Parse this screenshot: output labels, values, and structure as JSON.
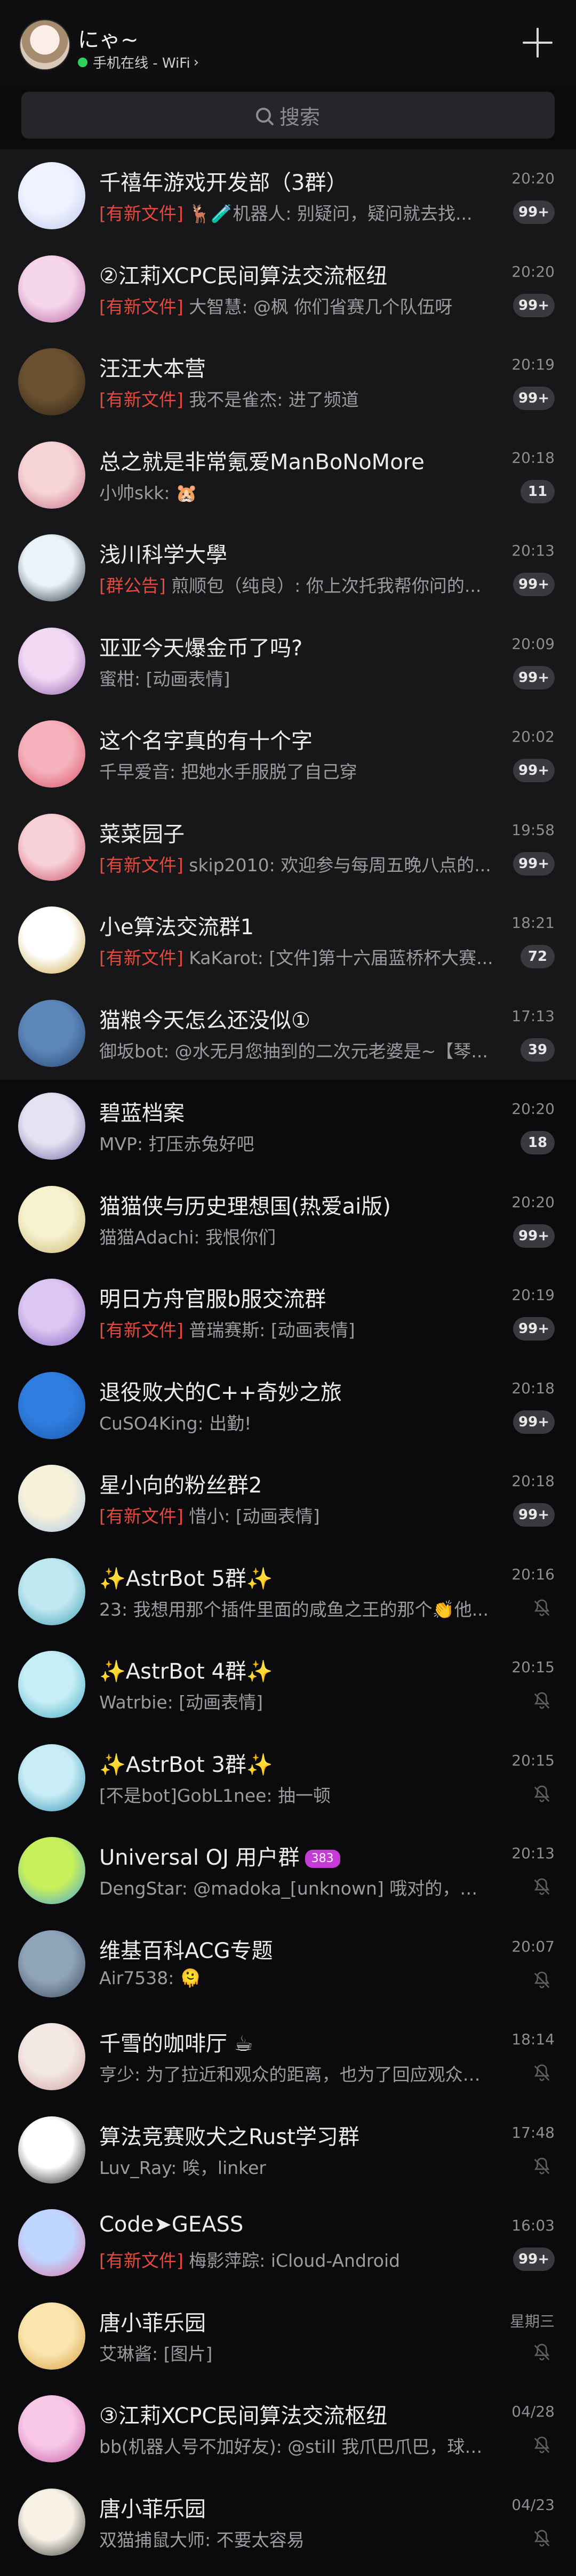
{
  "header": {
    "nickname": "にゃ~",
    "status": "手机在线 - WiFi",
    "status_chevron": "›"
  },
  "search": {
    "placeholder": "搜索"
  },
  "chats": [
    {
      "title": "千禧年游戏开发部（3群）",
      "tag": "[有新文件]",
      "preview": "🦌🧪机器人: 别疑问，疑问就去找...",
      "time": "20:20",
      "badge": "99+",
      "pinned": true,
      "c1": "#f0f2ff",
      "c2": "#b9c6ea"
    },
    {
      "title": "②江莉XCPC民间算法交流枢纽",
      "tag": "[有新文件]",
      "preview": "大智慧: @枫 你们省赛几个队伍呀",
      "time": "20:20",
      "badge": "99+",
      "pinned": true,
      "c1": "#f6d6ea",
      "c2": "#b55fa3"
    },
    {
      "title": "汪汪大本营",
      "tag": "[有新文件]",
      "preview": "我不是雀杰: 进了频道",
      "time": "20:19",
      "badge": "99+",
      "pinned": true,
      "c1": "#6b5130",
      "c2": "#2a2013"
    },
    {
      "title": "总之就是非常氪爱ManBoNoMore",
      "tag": "",
      "preview": "小帅skk: 🐹",
      "time": "20:18",
      "badge": "11",
      "pinned": true,
      "c1": "#f7d5d7",
      "c2": "#c46b86"
    },
    {
      "title": "浅川科学大學",
      "tag": "[群公告]",
      "preview": "煎顺包（纯良）: 你上次托我帮你问的...",
      "time": "20:13",
      "badge": "99+",
      "pinned": true,
      "c1": "#eaf3f8",
      "c2": "#1c2a3a"
    },
    {
      "title": "亚亚今天爆金币了吗?",
      "tag": "",
      "preview": "蜜柑: [动画表情]",
      "time": "20:09",
      "badge": "99+",
      "pinned": true,
      "c1": "#f1d9f4",
      "c2": "#8c5aa6"
    },
    {
      "title": "这个名字真的有十个字",
      "tag": "",
      "preview": "千早爱音: 把她水手服脱了自己穿",
      "time": "20:02",
      "badge": "99+",
      "pinned": true,
      "c1": "#f5b2bc",
      "c2": "#d84d62"
    },
    {
      "title": "菜菜园子",
      "tag": "[有新文件]",
      "preview": "skip2010: 欢迎参与每周五晚八点的...",
      "time": "19:58",
      "badge": "99+",
      "pinned": true,
      "c1": "#f8d0d8",
      "c2": "#c84b5c"
    },
    {
      "title": "小e算法交流群1",
      "tag": "[有新文件]",
      "preview": "KaKarot: [文件]第十六届蓝桥杯大赛...",
      "time": "18:21",
      "badge": "72",
      "pinned": true,
      "c1": "#ffffff",
      "c2": "#c9a235"
    },
    {
      "title": "猫粮今天怎么还没似①",
      "tag": "",
      "preview": "御坂bot: @水无月您抽到的二次元老婆是~【琴...",
      "time": "17:13",
      "badge": "39",
      "pinned": true,
      "c1": "#5d86b9",
      "c2": "#23446f"
    },
    {
      "title": "碧蓝档案",
      "tag": "",
      "preview": "MVP: 打压赤兔好吧",
      "time": "20:20",
      "badge": "18",
      "pinned": false,
      "c1": "#e6e2f2",
      "c2": "#6f63a0"
    },
    {
      "title": "猫猫侠与历史理想国(热爱ai版)",
      "tag": "",
      "preview": "猫猫Adachi: 我恨你们",
      "time": "20:20",
      "badge": "99+",
      "pinned": false,
      "c1": "#f6f1cf",
      "c2": "#c9b36a"
    },
    {
      "title": "明日方舟官服b服交流群",
      "tag": "[有新文件]",
      "preview": "普瑞赛斯: [动画表情]",
      "time": "20:19",
      "badge": "99+",
      "pinned": false,
      "c1": "#dcc6f2",
      "c2": "#8461c1"
    },
    {
      "title": "退役败犬的C++奇妙之旅",
      "tag": "",
      "preview": "CuSO4King: 出勤!",
      "time": "20:18",
      "badge": "99+",
      "pinned": false,
      "c1": "#2f7de0",
      "c2": "#1d57a8"
    },
    {
      "title": "星小向的粉丝群2",
      "tag": "[有新文件]",
      "preview": "惜小: [动画表情]",
      "time": "20:18",
      "badge": "99+",
      "pinned": false,
      "c1": "#f7f1da",
      "c2": "#a7c5e8"
    },
    {
      "title": "✨AstrBot 5群✨",
      "tag": "",
      "preview": "23: 我想用那个插件里面的咸鱼之王的那个👏他...",
      "time": "20:16",
      "badge": "",
      "pinned": false,
      "c1": "#bfe8f1",
      "c2": "#3c9db5"
    },
    {
      "title": "✨AstrBot 4群✨",
      "tag": "",
      "preview": "Watrbie: [动画表情]",
      "time": "20:15",
      "badge": "",
      "pinned": false,
      "c1": "#c6eef6",
      "c2": "#3ea7c0"
    },
    {
      "title": "✨AstrBot 3群✨",
      "tag": "",
      "preview": "[不是bot]GobL1nee: 抽一顿",
      "time": "20:15",
      "badge": "",
      "pinned": false,
      "c1": "#c8edf6",
      "c2": "#2e8fb0"
    },
    {
      "title": "Universal OJ 用户群",
      "tag": "",
      "preview": "DengStar: @madoka_[unknown] 哦对的，我🍋...",
      "time": "20:13",
      "badge": "",
      "level": "383",
      "pinned": false,
      "c1": "#c8f05a",
      "c2": "#3aa0e4"
    },
    {
      "title": "维基百科ACG专题",
      "tag": "",
      "preview": "Air7538: 🫠",
      "time": "20:07",
      "badge": "",
      "pinned": false,
      "c1": "#8fa3b9",
      "c2": "#3b4a5b"
    },
    {
      "title": "千雪的咖啡厅 ☕",
      "tag": "",
      "preview": "亨少: 为了拉近和观众的距离，也为了回应观众们...",
      "time": "18:14",
      "badge": "",
      "pinned": false,
      "c1": "#f3e8e4",
      "c2": "#cf9c9a"
    },
    {
      "title": "算法竞赛败犬之Rust学习群",
      "tag": "",
      "preview": "Luv_Ray: 唉，linker",
      "time": "17:48",
      "badge": "",
      "pinned": false,
      "c1": "#ffffff",
      "c2": "#111111"
    },
    {
      "title": "Code➤GEASS",
      "tag": "[有新文件]",
      "preview": "梅影萍踪: iCloud-Android",
      "time": "16:03",
      "badge": "99+",
      "pinned": false,
      "c1": "#bfd6ff",
      "c2": "#e06ba0"
    },
    {
      "title": "唐小菲乐园",
      "tag": "",
      "preview": "艾琳酱: [图片]",
      "time": "星期三",
      "badge": "",
      "pinned": false,
      "c1": "#fbe6b0",
      "c2": "#d39a3b"
    },
    {
      "title": "③江莉XCPC民间算法交流枢纽",
      "tag": "",
      "preview": "bb(机器人号不加好友): @still 我爪巴爪巴，球球...",
      "time": "04/28",
      "badge": "",
      "pinned": false,
      "c1": "#f8c8e6",
      "c2": "#c25aa4"
    },
    {
      "title": "唐小菲乐园",
      "tag": "",
      "preview": "双猫捕鼠大师: 不要太容易",
      "time": "04/23",
      "badge": "",
      "pinned": false,
      "c1": "#f7f1e6",
      "c2": "#333333"
    }
  ]
}
